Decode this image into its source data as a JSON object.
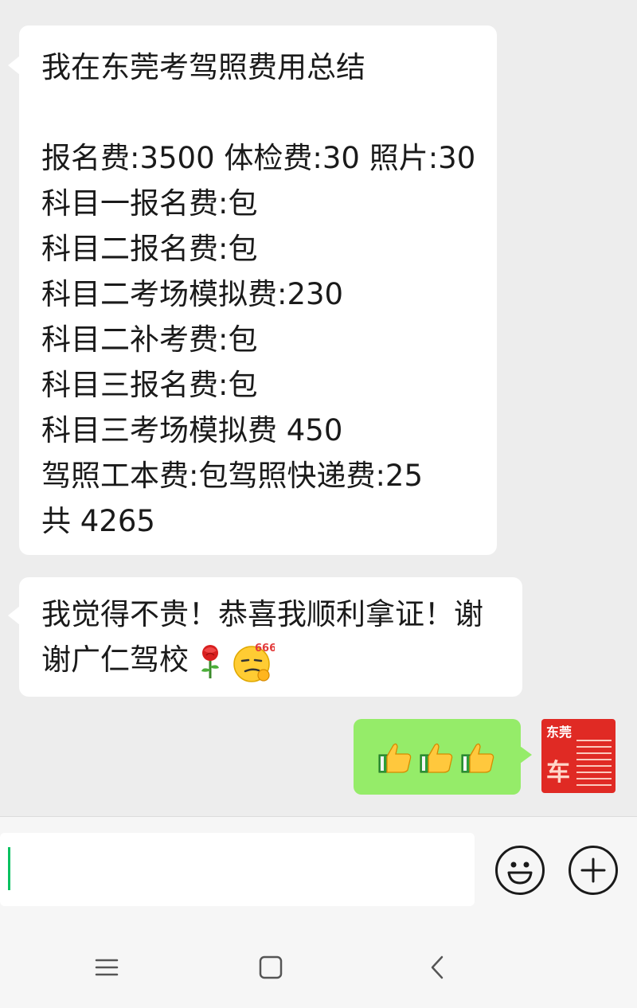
{
  "messages": [
    {
      "direction": "incoming",
      "lines": [
        "我在东莞考驾照费用总结",
        "",
        "报名费:3500 体检费:30 照片:30",
        "科目一报名费:包",
        "科目二报名费:包",
        "科目二考场模拟费:230",
        "科目二补考费:包",
        "科目三报名费:包",
        "科目三考场模拟费 450",
        "驾照工本费:包驾照快递费:25",
        "共 4265"
      ]
    },
    {
      "direction": "incoming",
      "line1": "我觉得不贵！恭喜我顺利拿证！谢",
      "line2": "谢广仁驾校",
      "emojis": [
        "rose-icon",
        "smirk-666-icon"
      ]
    },
    {
      "direction": "outgoing",
      "emojis": [
        "thumbs-up-icon",
        "thumbs-up-icon",
        "thumbs-up-icon"
      ]
    }
  ],
  "avatar": {
    "text_top": "东莞",
    "text_big": "车"
  },
  "input": {
    "value": "",
    "buttons": [
      "emoji-icon",
      "plus-icon"
    ]
  },
  "nav": [
    "menu-icon",
    "home-icon",
    "back-icon"
  ],
  "colors": {
    "chat_bg": "#ededed",
    "incoming_bubble": "#ffffff",
    "outgoing_bubble": "#95ec69",
    "caret": "#07c160",
    "avatar_bg": "#e02a24"
  }
}
